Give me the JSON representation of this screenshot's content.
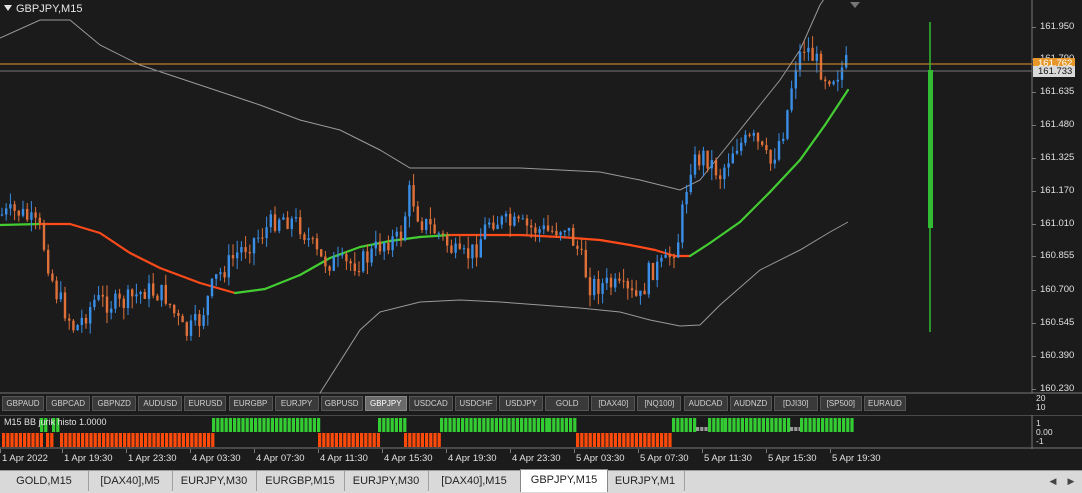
{
  "window": {
    "chart_title": "GBPJPY,M15",
    "indicator_title": "M15  BB jurik histo  1.0000"
  },
  "price_axis": {
    "ticks": [
      "161.950",
      "161.790",
      "161.635",
      "161.480",
      "161.325",
      "161.170",
      "161.010",
      "160.855",
      "160.700",
      "160.545",
      "160.390",
      "160.230"
    ],
    "current_price_label": "161.762",
    "bid_label": "161.733"
  },
  "indicator_axis": {
    "top_ticks": [
      "20",
      "10"
    ],
    "ticks": [
      "1",
      "0.00",
      "-1"
    ]
  },
  "time_axis": {
    "labels": [
      "1 Apr 2022",
      "1 Apr 19:30",
      "1 Apr 23:30",
      "4 Apr 03:30",
      "4 Apr 07:30",
      "4 Apr 11:30",
      "4 Apr 15:30",
      "4 Apr 19:30",
      "4 Apr 23:30",
      "5 Apr 03:30",
      "5 Apr 07:30",
      "5 Apr 11:30",
      "5 Apr 15:30",
      "5 Apr 19:30"
    ]
  },
  "symbol_buttons": [
    "GBPAUD",
    "GBPCAD",
    "GBPNZD",
    "AUDUSD",
    "EURUSD",
    "EURGBP",
    "EURJPY",
    "GBPUSD",
    "GBPJPY",
    "USDCAD",
    "USDCHF",
    "USDJPY",
    "GOLD",
    "[DAX40]",
    "[NQ100]",
    "AUDCAD",
    "AUDNZD",
    "[DJI30]",
    "[SP500]",
    "EURAUD"
  ],
  "active_symbol": "GBPJPY",
  "tabs": [
    "GOLD,M15",
    "[DAX40],M5",
    "EURJPY,M30",
    "EURGBP,M15",
    "EURJPY,M30",
    "[DAX40],M15",
    "GBPJPY,M15",
    "EURJPY,M1"
  ],
  "active_tab": "GBPJPY,M15",
  "colors": {
    "background": "#1b1b1b",
    "bull_candle": "#3a8ee6",
    "bear_candle": "#e0703a",
    "ma_up": "#44cc33",
    "ma_down": "#ff4a1a",
    "bands": "#9a9a9a",
    "price_line": "#e8972a",
    "hist_up": "#33cc33",
    "hist_down": "#ff4a0a",
    "volume_bar": "#33bb33"
  }
}
